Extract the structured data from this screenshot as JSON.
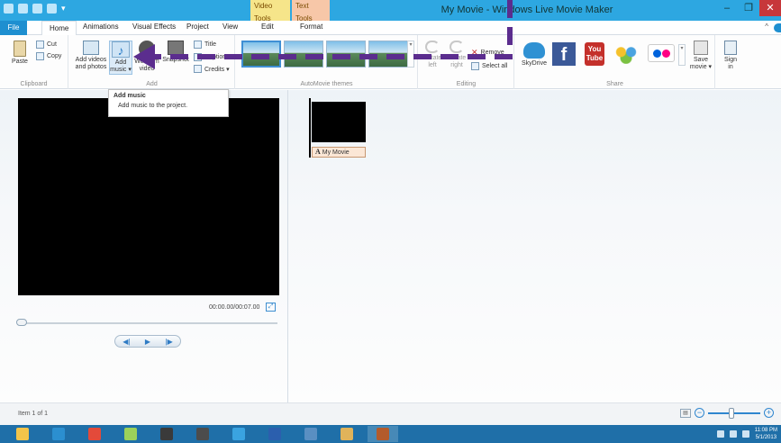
{
  "window": {
    "title": "My Movie - Windows Live Movie Maker",
    "context_tabs": {
      "video_tools": "Video Tools",
      "text_tools": "Text Tools"
    },
    "controls": {
      "minimize": "–",
      "maximize": "❐",
      "close": "✕"
    }
  },
  "tabs": [
    {
      "label": "File"
    },
    {
      "label": "Home"
    },
    {
      "label": "Animations"
    },
    {
      "label": "Visual Effects"
    },
    {
      "label": "Project"
    },
    {
      "label": "View"
    },
    {
      "label": "Edit"
    },
    {
      "label": "Format"
    }
  ],
  "ribbon": {
    "clipboard": {
      "label": "Clipboard",
      "paste": "Paste",
      "cut": "Cut",
      "copy": "Copy"
    },
    "add": {
      "label": "Add",
      "add_videos": "Add videos",
      "add_videos_2": "and photos",
      "add_music": "Add",
      "add_music_2": "music ▾",
      "webcam": "Webcam",
      "webcam_2": "video",
      "snapshot": "Snapshot",
      "title": "Title",
      "caption": "Caption",
      "credits": "Credits ▾"
    },
    "themes": {
      "label": "AutoMovie themes",
      "more": "▾"
    },
    "editing": {
      "label": "Editing",
      "rotate_left": "Rotate",
      "rotate_left_2": "left",
      "rotate_right": "Rotate",
      "rotate_right_2": "right",
      "remove": "Remove",
      "select_all": "Select all"
    },
    "share": {
      "label": "Share",
      "skydrive": "SkyDrive",
      "youtube_1": "You",
      "youtube_2": "Tube",
      "facebook": "f",
      "save_movie": "Save",
      "save_movie_2": "movie ▾",
      "sign_in": "Sign",
      "sign_in_2": "in"
    }
  },
  "tooltip": {
    "title": "Add music",
    "description": "Add music to the project."
  },
  "preview": {
    "time": "00:00.00/00:07.00",
    "playback": {
      "prev": "◀|",
      "play": "▶",
      "next": "|▶"
    }
  },
  "storyboard": {
    "clip_caption": "My Movie",
    "clip_caption_icon": "A"
  },
  "status": {
    "item": "Item 1 of 1",
    "zoom_out": "−",
    "zoom_in": "+",
    "zoom_level": 0.45
  },
  "taskbar": {
    "apps": [
      "file-explorer",
      "hp",
      "chrome",
      "picasa",
      "media-player",
      "movie-maker",
      "internet-explorer",
      "word",
      "other-app",
      "paint",
      "movie-maker-active"
    ],
    "clock_time": "11:08 PM",
    "clock_date": "5/1/2013"
  },
  "colors": {
    "titlebar": "#2da7e1",
    "file_tab": "#1e8fd0",
    "arrow": "#5b2d8e",
    "taskbar": "#1f6fa8"
  }
}
